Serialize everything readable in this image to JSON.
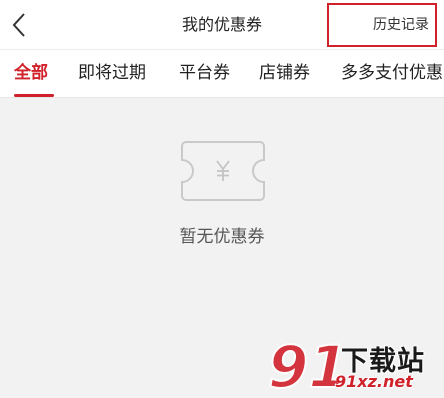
{
  "header": {
    "title": "我的优惠券",
    "history_label": "历史记录"
  },
  "tabs": [
    {
      "label": "全部",
      "active": true
    },
    {
      "label": "即将过期",
      "active": false
    },
    {
      "label": "平台券",
      "active": false
    },
    {
      "label": "店铺券",
      "active": false
    },
    {
      "label": "多多支付优惠",
      "active": false
    }
  ],
  "empty_state": {
    "icon": "coupon-yen-icon",
    "text": "暂无优惠券"
  },
  "watermark": {
    "logo_text": "91",
    "site_name": "下载站",
    "url": "91xz.net"
  },
  "colors": {
    "accent": "#d0202a",
    "background": "#f2f2f2"
  }
}
